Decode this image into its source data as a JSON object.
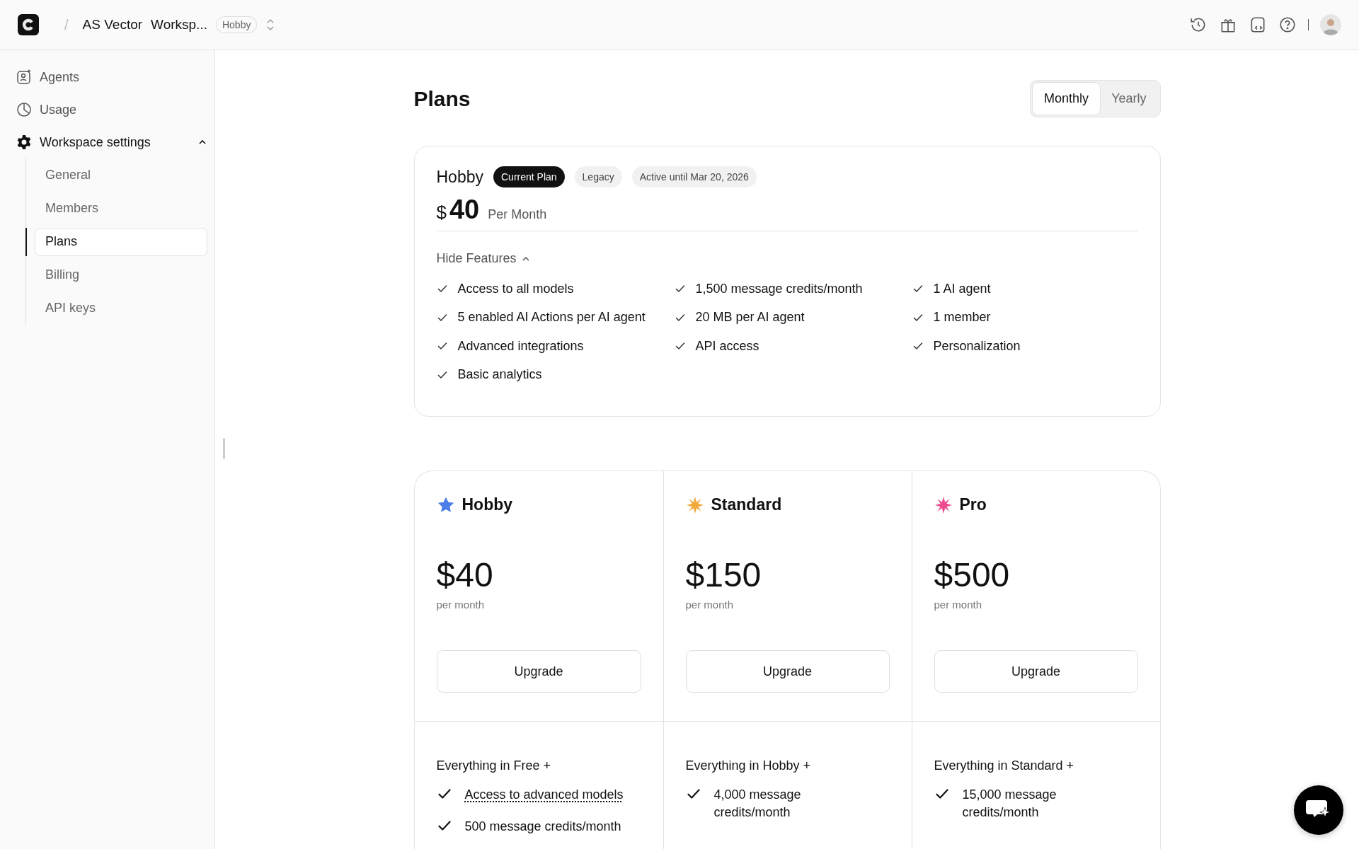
{
  "topbar": {
    "breadcrumb_separator": "/",
    "workspace_owner": "AS Vector",
    "workspace_name": "Worksp...",
    "plan_badge": "Hobby"
  },
  "sidebar": {
    "items": [
      {
        "label": "Agents",
        "kind": "agents"
      },
      {
        "label": "Usage",
        "kind": "usage"
      },
      {
        "label": "Workspace settings",
        "kind": "settings",
        "expanded": true,
        "children": [
          {
            "label": "General",
            "selected": false
          },
          {
            "label": "Members",
            "selected": false
          },
          {
            "label": "Plans",
            "selected": true
          },
          {
            "label": "Billing",
            "selected": false
          },
          {
            "label": "API keys",
            "selected": false
          }
        ]
      }
    ]
  },
  "page": {
    "title": "Plans",
    "billing_toggle": [
      {
        "label": "Monthly",
        "selected": true
      },
      {
        "label": "Yearly",
        "selected": false
      }
    ]
  },
  "current_plan": {
    "name": "Hobby",
    "badges": [
      {
        "label": "Current Plan",
        "kind": "dark"
      },
      {
        "label": "Legacy",
        "kind": "light"
      },
      {
        "label": "Active until Mar 20, 2026",
        "kind": "light"
      }
    ],
    "currency": "$",
    "price": "40",
    "period": "Per Month",
    "features_toggle": "Hide Features",
    "features_expanded": true,
    "features": [
      [
        "Access to all models",
        "5 enabled AI Actions per AI agent",
        "Advanced integrations",
        "Basic analytics"
      ],
      [
        "1,500 message credits/month",
        "20 MB per AI agent",
        "API access"
      ],
      [
        "1 AI agent",
        "1 member",
        "Personalization"
      ]
    ]
  },
  "plans": [
    {
      "name": "Hobby",
      "kind": "star",
      "color": "#4a7de8",
      "price": "$40",
      "period": "per month",
      "button": "Upgrade",
      "includes": "Everything in Free +",
      "features": [
        {
          "text": "Access to advanced models",
          "dotted_underline": true
        },
        {
          "text": "500 message credits/month",
          "dotted_underline": false
        }
      ]
    },
    {
      "name": "Standard",
      "kind": "burst",
      "color": "#f2a93b",
      "price": "$150",
      "period": "per month",
      "button": "Upgrade",
      "includes": "Everything in Hobby +",
      "features": [
        {
          "text": "4,000 message credits/month",
          "dotted_underline": false
        }
      ]
    },
    {
      "name": "Pro",
      "kind": "burst",
      "color": "#ee4b8f",
      "price": "$500",
      "period": "per month",
      "button": "Upgrade",
      "includes": "Everything in Standard +",
      "features": [
        {
          "text": "15,000 message credits/month",
          "dotted_underline": false
        }
      ]
    }
  ]
}
